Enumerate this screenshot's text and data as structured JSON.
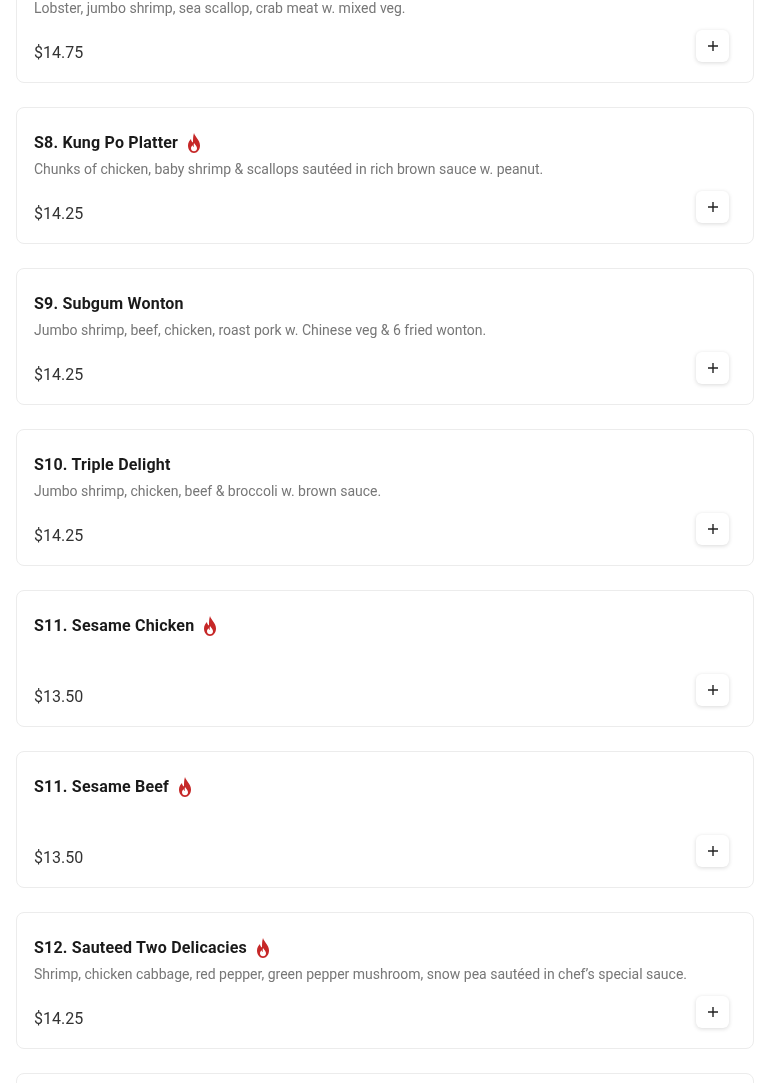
{
  "menu_items": [
    {
      "description": "Lobster, jumbo shrimp, sea scallop, crab meat w. mixed veg.",
      "price": "$14.75"
    },
    {
      "name": "S8. Kung Po Platter",
      "spicy": true,
      "description": "Chunks of chicken, baby shrimp & scallops sautéed in rich brown sauce w. peanut.",
      "price": "$14.25"
    },
    {
      "name": "S9. Subgum Wonton",
      "spicy": false,
      "description": "Jumbo shrimp, beef, chicken, roast pork w. Chinese veg & 6 fried wonton.",
      "price": "$14.25"
    },
    {
      "name": "S10. Triple Delight",
      "spicy": false,
      "description": "Jumbo shrimp, chicken, beef & broccoli w. brown sauce.",
      "price": "$14.25"
    },
    {
      "name": "S11. Sesame Chicken",
      "spicy": true,
      "price": "$13.50"
    },
    {
      "name": "S11. Sesame Beef",
      "spicy": true,
      "price": "$13.50"
    },
    {
      "name": "S12. Sauteed Two Delicacies",
      "spicy": true,
      "description": "Shrimp, chicken cabbage, red pepper, green pepper mushroom, snow pea sautéed in chef’s special sauce.",
      "price": "$14.25"
    }
  ]
}
